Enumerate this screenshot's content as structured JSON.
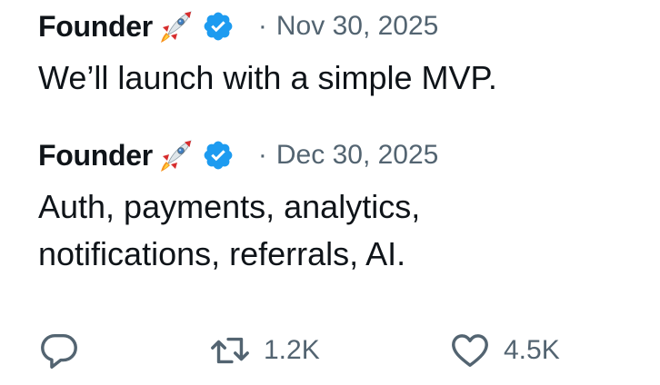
{
  "posts": [
    {
      "author": "Founder",
      "author_emoji_icon": "rocket-icon",
      "verified_icon": "verified-badge-icon",
      "separator": "·",
      "date": "Nov 30, 2025",
      "text_lines": [
        "We’ll launch with a simple MVP."
      ]
    },
    {
      "author": "Founder",
      "author_emoji_icon": "rocket-icon",
      "verified_icon": "verified-badge-icon",
      "separator": "·",
      "date": "Dec 30, 2025",
      "text_lines": [
        "Auth, payments, analytics,",
        "notifications, referrals, AI."
      ]
    }
  ],
  "actions": {
    "reply": {
      "icon": "reply-icon"
    },
    "retweet": {
      "icon": "retweet-icon",
      "count": "1.2K"
    },
    "like": {
      "icon": "heart-icon",
      "count": "4.5K"
    }
  },
  "colors": {
    "text": "#0f1419",
    "muted": "#536471",
    "verified": "#1d9bf0",
    "background": "#ffffff"
  }
}
